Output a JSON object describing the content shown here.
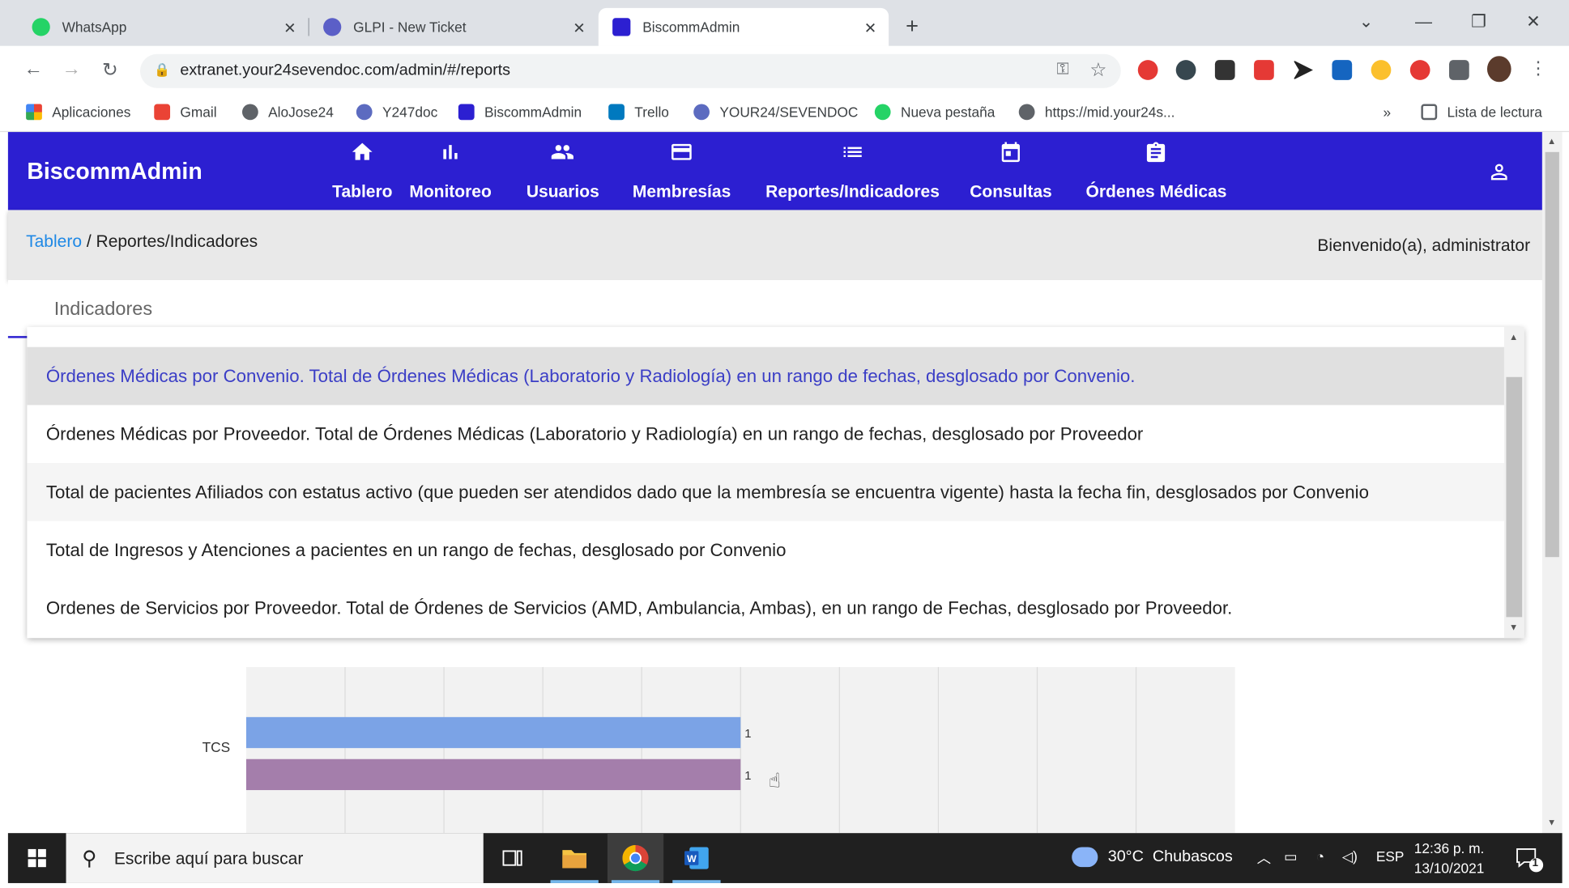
{
  "browser": {
    "tabs": [
      {
        "title": "WhatsApp",
        "color": "#25d366"
      },
      {
        "title": "GLPI - New Ticket",
        "color": "#5b5fc7"
      },
      {
        "title": "BiscommAdmin",
        "color": "#2c1fd1"
      }
    ],
    "url": "extranet.your24sevendoc.com/admin/#/reports",
    "bookmarks": [
      {
        "label": "Aplicaciones"
      },
      {
        "label": "Gmail"
      },
      {
        "label": "AloJose24"
      },
      {
        "label": "Y247doc"
      },
      {
        "label": "BiscommAdmin"
      },
      {
        "label": "Trello"
      },
      {
        "label": "YOUR24/SEVENDOC"
      },
      {
        "label": "Nueva pestaña"
      },
      {
        "label": "https://mid.your24s..."
      }
    ],
    "more_bookmarks": "»",
    "reading_list": "Lista de lectura"
  },
  "app": {
    "brand": "BiscommAdmin",
    "header_color": "#2c1fd1",
    "nav": [
      {
        "label": "Tablero",
        "icon": "home-icon"
      },
      {
        "label": "Monitoreo",
        "icon": "bar-chart-icon"
      },
      {
        "label": "Usuarios",
        "icon": "people-icon"
      },
      {
        "label": "Membresías",
        "icon": "credit-card-icon"
      },
      {
        "label": "Reportes/Indicadores",
        "icon": "list-icon"
      },
      {
        "label": "Consultas",
        "icon": "calendar-icon"
      },
      {
        "label": "Órdenes Médicas",
        "icon": "clipboard-icon"
      }
    ],
    "breadcrumb": {
      "root": "Tablero",
      "separator": " / ",
      "current": "Reportes/Indicadores"
    },
    "welcome": "Bienvenido(a), administrator",
    "section_title": "Indicadores"
  },
  "dropdown": {
    "options": [
      "Órdenes Médicas por Convenio. Total de Órdenes Médicas (Laboratorio y Radiología) en un rango de fechas, desglosado por Convenio.",
      "Órdenes Médicas por Proveedor. Total de Órdenes Médicas (Laboratorio y Radiología) en un rango de fechas, desglosado por Proveedor",
      "Total de pacientes Afiliados con estatus activo (que pueden ser atendidos dado que la membresía se encuentra vigente) hasta la fecha fin, desglosados por Convenio",
      "Total de Ingresos y Atenciones a pacientes en un rango de fechas, desglosado por Convenio",
      "Ordenes de Servicios por Proveedor. Total de Órdenes de Servicios (AMD, Ambulancia, Ambas), en un rango de Fechas, desglosado por Proveedor."
    ],
    "selected_index": 0,
    "hover_index": 2
  },
  "chart_data": {
    "type": "bar",
    "orientation": "horizontal",
    "categories": [
      "TCS"
    ],
    "series": [
      {
        "values": [
          1
        ],
        "color": "#7ba3e6"
      },
      {
        "values": [
          1
        ],
        "color": "#a47eab"
      }
    ],
    "data_labels": [
      "1",
      "1"
    ],
    "xlim": [
      0,
      2
    ],
    "grid": true
  },
  "taskbar": {
    "search_placeholder": "Escribe aquí para buscar",
    "weather": "30°C  Chubascos",
    "language": "ESP",
    "time": "12:36 p. m.",
    "date": "13/10/2021",
    "notifications": "1"
  }
}
